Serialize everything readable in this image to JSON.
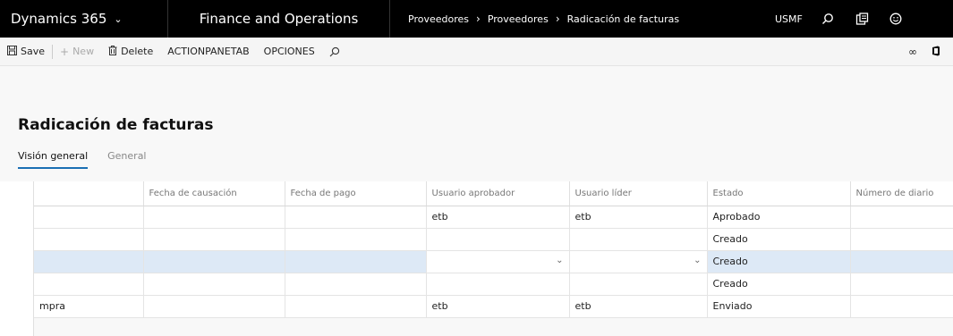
{
  "topbar": {
    "brand": "Dynamics 365",
    "module": "Finance and Operations",
    "breadcrumbs": [
      "Proveedores",
      "Proveedores",
      "Radicación de facturas"
    ],
    "company": "USMF"
  },
  "actionpane": {
    "save": "Save",
    "new": "New",
    "delete": "Delete",
    "actionpanetab": "ACTIONPANETAB",
    "opciones": "OPCIONES"
  },
  "page": {
    "title": "Radicación de facturas",
    "tabs": [
      "Visión general",
      "General"
    ]
  },
  "grid": {
    "columns": [
      "",
      "Fecha de causación",
      "Fecha de pago",
      "Usuario aprobador",
      "Usuario líder",
      "Estado",
      "Número de diario"
    ],
    "rows": [
      [
        "",
        "",
        "",
        "etb",
        "etb",
        "Aprobado",
        ""
      ],
      [
        "",
        "",
        "",
        "",
        "",
        "Creado",
        ""
      ],
      [
        "",
        "",
        "",
        "",
        "",
        "Creado",
        ""
      ],
      [
        "",
        "",
        "",
        "",
        "",
        "Creado",
        ""
      ],
      [
        "mpra",
        "",
        "",
        "etb",
        "etb",
        "Enviado",
        ""
      ]
    ],
    "selected_row": 2
  },
  "colors": {
    "topbar": "#000000",
    "selected_row": "#dde9f6",
    "tab_underline": "#1a6fb4"
  }
}
